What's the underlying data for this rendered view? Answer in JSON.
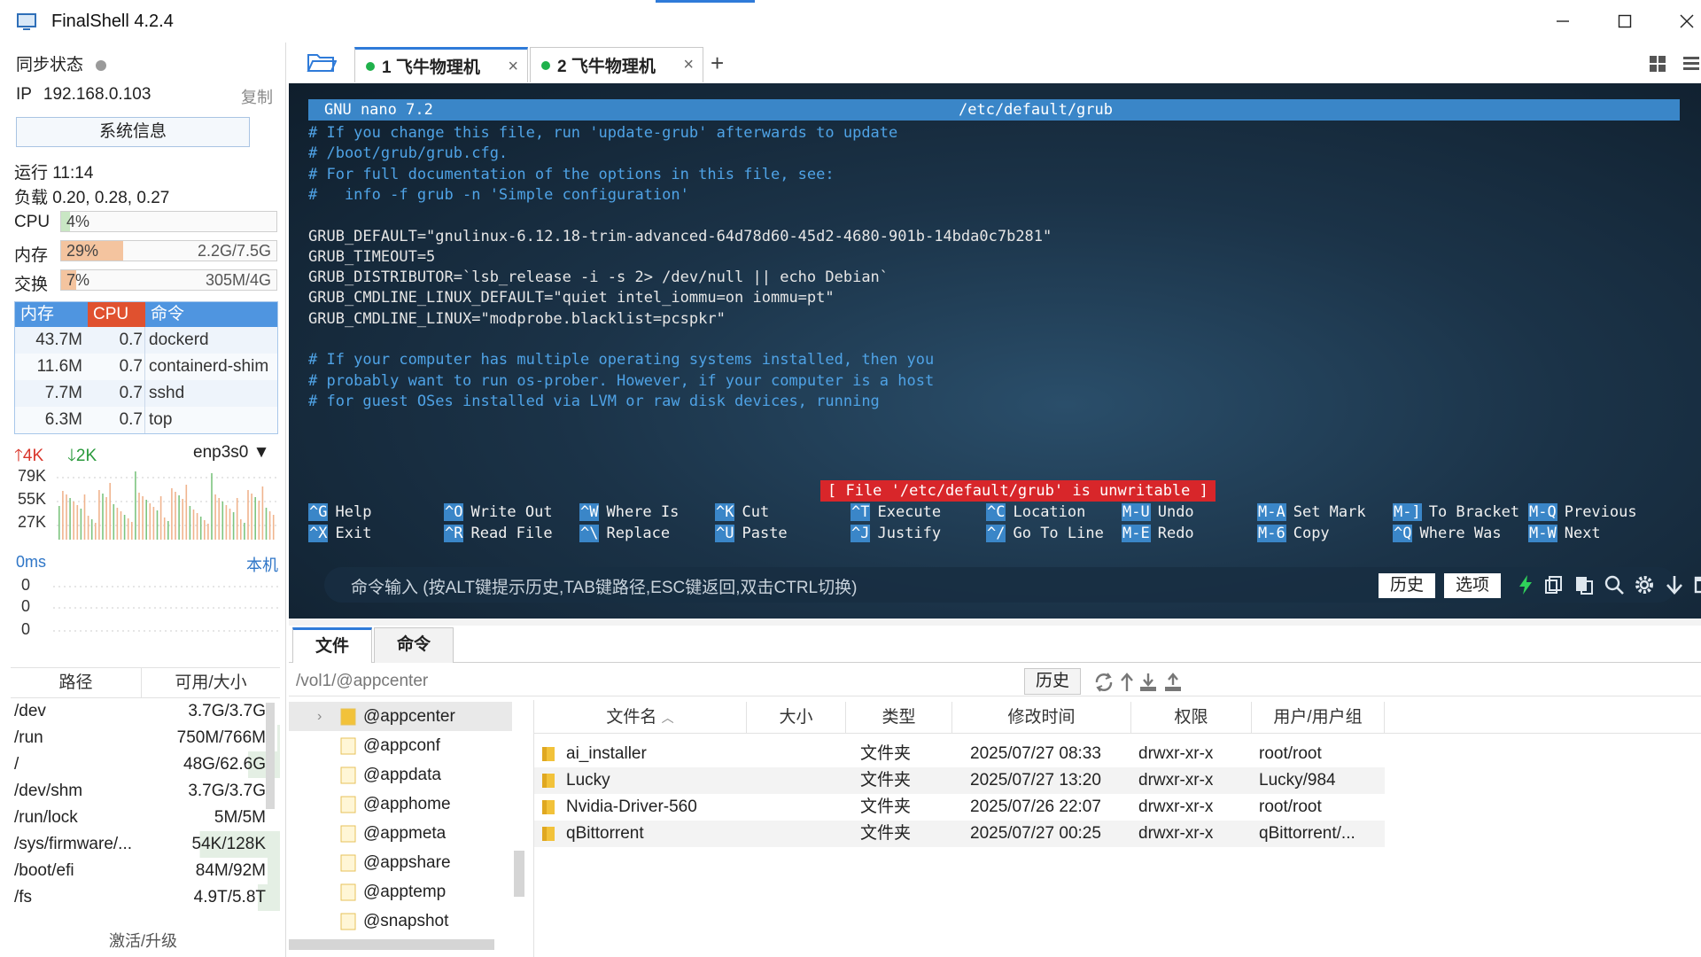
{
  "app": {
    "title": "FinalShell 4.2.4"
  },
  "status": {
    "sync_label": "同步状态",
    "ip_label": "IP",
    "ip": "192.168.0.103",
    "copy_label": "复制",
    "sysinfo_button": "系统信息",
    "uptime": "运行 11:14",
    "load": "负载 0.20, 0.28, 0.27",
    "cpu": {
      "label": "CPU",
      "pct_text": "4%",
      "fraction": 0.04
    },
    "mem": {
      "label": "内存",
      "pct_text": "29%",
      "fraction": 0.29,
      "amount": "2.2G/7.5G"
    },
    "swap": {
      "label": "交换",
      "pct_text": "7%",
      "fraction": 0.07,
      "amount": "305M/4G"
    }
  },
  "processes": {
    "headers": [
      "内存",
      "CPU",
      "命令"
    ],
    "rows": [
      {
        "mem": "43.7M",
        "cpu": "0.7",
        "cmd": "dockerd"
      },
      {
        "mem": "11.6M",
        "cpu": "0.7",
        "cmd": "containerd-shim"
      },
      {
        "mem": "7.7M",
        "cpu": "0.7",
        "cmd": "sshd"
      },
      {
        "mem": "6.3M",
        "cpu": "0.7",
        "cmd": "top"
      }
    ]
  },
  "network": {
    "up": "4K",
    "down": "2K",
    "interface": "enp3s0",
    "y_labels": [
      "79K",
      "55K",
      "27K"
    ]
  },
  "latency": {
    "ms": "0ms",
    "target": "本机",
    "y_labels": [
      "0",
      "0",
      "0"
    ]
  },
  "disks": {
    "headers": [
      "路径",
      "可用/大小"
    ],
    "rows": [
      {
        "path": "/dev",
        "size": "3.7G/3.7G",
        "used": 0.0
      },
      {
        "path": "/run",
        "size": "750M/766M",
        "used": 0.02
      },
      {
        "path": "/",
        "size": "48G/62.6G",
        "used": 0.23
      },
      {
        "path": "/dev/shm",
        "size": "3.7G/3.7G",
        "used": 0.0
      },
      {
        "path": "/run/lock",
        "size": "5M/5M",
        "used": 0.0
      },
      {
        "path": "/sys/firmware/...",
        "size": "54K/128K",
        "used": 0.58
      },
      {
        "path": "/boot/efi",
        "size": "84M/92M",
        "used": 0.09
      },
      {
        "path": "/fs",
        "size": "4.9T/5.8T",
        "used": 0.16
      }
    ],
    "activate": "激活/升级"
  },
  "tabs": [
    {
      "label": "1 飞牛物理机"
    },
    {
      "label": "2 飞牛物理机"
    }
  ],
  "terminal": {
    "nano_version": "GNU nano 7.2",
    "file_path": "/etc/default/grub",
    "lines": [
      {
        "text": "# If you change this file, run 'update-grub' afterwards to update",
        "comment": true
      },
      {
        "text": "# /boot/grub/grub.cfg.",
        "comment": true
      },
      {
        "text": "# For full documentation of the options in this file, see:",
        "comment": true
      },
      {
        "text": "#   info -f grub -n 'Simple configuration'",
        "comment": true
      },
      {
        "text": "",
        "comment": false
      },
      {
        "text": "GRUB_DEFAULT=\"gnulinux-6.12.18-trim-advanced-64d78d60-45d2-4680-901b-14bda0c7b281\"",
        "comment": false
      },
      {
        "text": "GRUB_TIMEOUT=5",
        "comment": false
      },
      {
        "text": "GRUB_DISTRIBUTOR=`lsb_release -i -s 2> /dev/null || echo Debian`",
        "comment": false
      },
      {
        "text": "GRUB_CMDLINE_LINUX_DEFAULT=\"quiet intel_iommu=on iommu=pt\"",
        "comment": false
      },
      {
        "text": "GRUB_CMDLINE_LINUX=\"modprobe.blacklist=pcspkr\"",
        "comment": false
      },
      {
        "text": "",
        "comment": false
      },
      {
        "text": "# If your computer has multiple operating systems installed, then you",
        "comment": true
      },
      {
        "text": "# probably want to run os-prober. However, if your computer is a host",
        "comment": true
      },
      {
        "text": "# for guest OSes installed via LVM or raw disk devices, running",
        "comment": true
      }
    ],
    "warning": "[ File '/etc/default/grub' is unwritable ]",
    "shortcuts": [
      [
        {
          "key": "^G",
          "label": "Help"
        },
        {
          "key": "^O",
          "label": "Write Out"
        },
        {
          "key": "^W",
          "label": "Where Is"
        },
        {
          "key": "^K",
          "label": "Cut"
        },
        {
          "key": "^T",
          "label": "Execute"
        },
        {
          "key": "^C",
          "label": "Location"
        },
        {
          "key": "M-U",
          "label": "Undo"
        },
        {
          "key": "M-A",
          "label": "Set Mark"
        },
        {
          "key": "M-]",
          "label": "To Bracket"
        },
        {
          "key": "M-Q",
          "label": "Previous"
        }
      ],
      [
        {
          "key": "^X",
          "label": "Exit"
        },
        {
          "key": "^R",
          "label": "Read File"
        },
        {
          "key": "^\\",
          "label": "Replace"
        },
        {
          "key": "^U",
          "label": "Paste"
        },
        {
          "key": "^J",
          "label": "Justify"
        },
        {
          "key": "^/",
          "label": "Go To Line"
        },
        {
          "key": "M-E",
          "label": "Redo"
        },
        {
          "key": "M-6",
          "label": "Copy"
        },
        {
          "key": "^Q",
          "label": "Where Was"
        },
        {
          "key": "M-W",
          "label": "Next"
        }
      ]
    ],
    "command_placeholder": "命令输入 (按ALT键提示历史,TAB键路径,ESC键返回,双击CTRL切换)",
    "history_button": "历史",
    "options_button": "选项"
  },
  "bottom_tabs": [
    "文件",
    "命令"
  ],
  "files": {
    "path": "/vol1/@appcenter",
    "history_button": "历史",
    "tree": [
      "@appcenter",
      "@appconf",
      "@appdata",
      "@apphome",
      "@appmeta",
      "@appshare",
      "@apptemp",
      "@snapshot"
    ],
    "headers": [
      "文件名",
      "大小",
      "类型",
      "修改时间",
      "权限",
      "用户/用户组"
    ],
    "rows": [
      {
        "name": "ai_installer",
        "size": "",
        "type": "文件夹",
        "modified": "2025/07/27 08:33",
        "perm": "drwxr-xr-x",
        "owner": "root/root"
      },
      {
        "name": "Lucky",
        "size": "",
        "type": "文件夹",
        "modified": "2025/07/27 13:20",
        "perm": "drwxr-xr-x",
        "owner": "Lucky/984"
      },
      {
        "name": "Nvidia-Driver-560",
        "size": "",
        "type": "文件夹",
        "modified": "2025/07/26 22:07",
        "perm": "drwxr-xr-x",
        "owner": "root/root"
      },
      {
        "name": "qBittorrent",
        "size": "",
        "type": "文件夹",
        "modified": "2025/07/27 00:25",
        "perm": "drwxr-xr-x",
        "owner": "qBittorrent/..."
      }
    ]
  },
  "colors": {
    "accent": "#2f7bd9",
    "cpu_fill": "#c9e7c4",
    "mem_fill": "#f4c49f",
    "swap_fill": "#f4c49f",
    "terminal_comment": "#4fa3e6",
    "nano_bar": "#3a86c8",
    "warning": "#d8262a"
  }
}
